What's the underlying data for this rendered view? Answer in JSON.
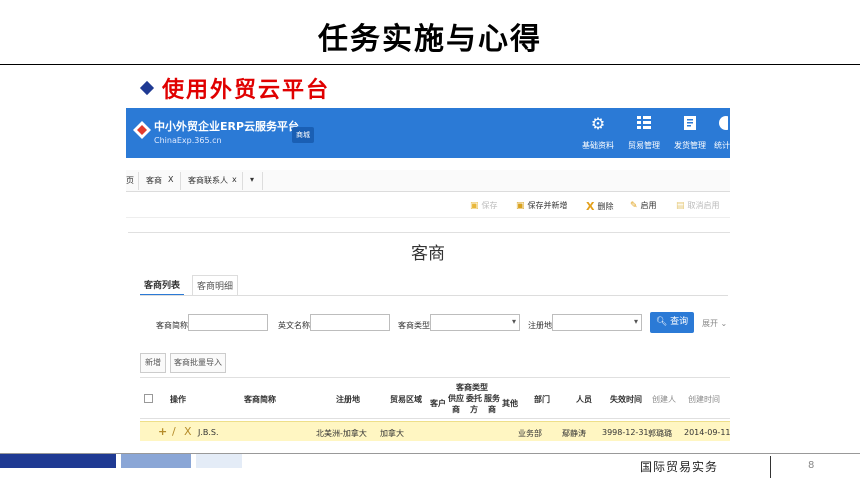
{
  "slide": {
    "title": "任务实施与心得",
    "bullet": "使用外贸云平台",
    "footer": "国际贸易实务",
    "page_number": "8"
  },
  "app": {
    "brand": "中小外贸企业ERP云服务平台",
    "brand_url": "ChinaExp.365.cn",
    "mall": "商城",
    "nav": [
      {
        "label": "基础资料",
        "icon": "gear-icon"
      },
      {
        "label": "贸易管理",
        "icon": "list-icon"
      },
      {
        "label": "发货管理",
        "icon": "document-icon"
      },
      {
        "label": "统计",
        "icon": "chart-icon"
      }
    ],
    "tabs": {
      "home": "页",
      "customer": "客商",
      "customer_close": "X",
      "contact": "客商联系人",
      "contact_close": "x",
      "more": "▾"
    },
    "toolbar": {
      "save": "保存",
      "save_new": "保存并新增",
      "delete": "删除",
      "enable": "启用",
      "disable": "取消启用"
    },
    "page_heading": "客商",
    "subtabs": {
      "list": "客商列表",
      "detail": "客商明细"
    },
    "filters": {
      "short_name": "客商简称",
      "english_name": "英文名称",
      "type": "客商类型",
      "reg_place": "注册地",
      "query": "查询",
      "expand": "展开"
    },
    "actions": {
      "add": "新增",
      "batch_import": "客商批量导入"
    },
    "table": {
      "headers": {
        "op": "操作",
        "short_name": "客商简称",
        "reg_place": "注册地",
        "region": "贸易区域",
        "type_group": "客商类型",
        "type_customer": "客户",
        "type_supplier_a": "供应",
        "type_supplier_b": "商",
        "type_consign_a": "委托",
        "type_consign_b": "方",
        "type_service_a": "服务",
        "type_service_b": "商",
        "type_other": "其他",
        "dept": "部门",
        "staff": "人员",
        "expire": "失效时间",
        "creator": "创建人",
        "created": "创建时间"
      },
      "rows": [
        {
          "add_icon": "+",
          "edit_icon": "/",
          "del_icon": "X",
          "short_name": "J.B.S.",
          "reg_place": "北美洲-加拿大",
          "region": "加拿大",
          "dept": "业务部",
          "staff": "鄢静涛",
          "expire": "3998-12-31",
          "creator": "郭璐璐",
          "created": "2014-09-11"
        }
      ]
    }
  },
  "colors": {
    "app_header": "#2b7ad6",
    "bullet_text": "#e00000",
    "row_highlight": "#fff6c2",
    "footer_block_dark": "#1f3a93",
    "footer_block_mid": "#8aa6d6",
    "footer_block_light": "#e4ecf7"
  }
}
